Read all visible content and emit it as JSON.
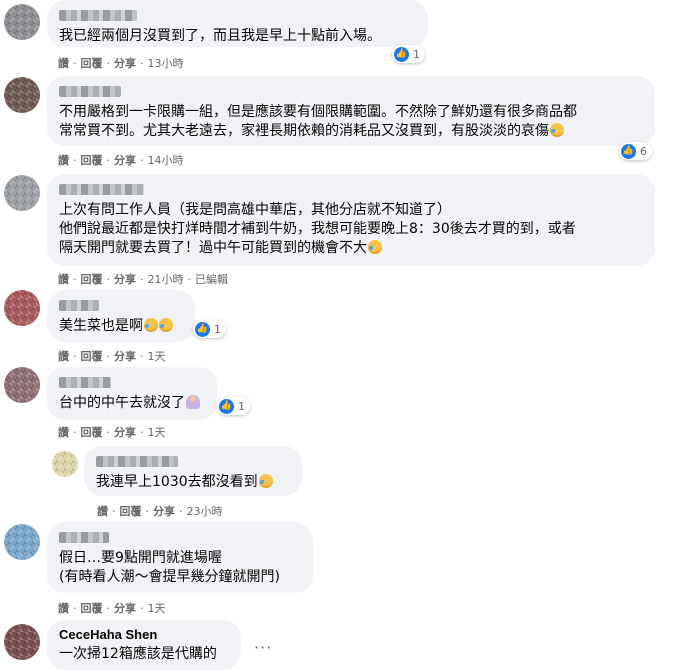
{
  "actions": {
    "like": "讚",
    "reply": "回覆",
    "share": "分享",
    "edited": "已編輯"
  },
  "comments": [
    {
      "text": "我已經兩個月沒買到了，而且我是早上十點前入場。",
      "reactions": "1",
      "time": "13小時"
    },
    {
      "text": "不用嚴格到一卡限購一組，但是應該要有個限購範圍。不然除了鮮奶還有很多商品都\n常常買不到。尤其大老遠去，家裡長期依賴的消耗品又沒買到，有股淡淡的哀傷",
      "reactions": "6",
      "time": "14小時"
    },
    {
      "text": "上次有問工作人員（我是問高雄中華店，其他分店就不知道了）\n他們說最近都是快打烊時間才補到牛奶，我想可能要晚上8：30後去才買的到，或者\n隔天開門就要去買了！過中午可能買到的機會不大",
      "time": "21小時"
    },
    {
      "text": "美生菜也是啊",
      "reactions": "1",
      "time": "1天"
    },
    {
      "text": "台中的中午去就沒了",
      "reactions": "1",
      "time": "1天"
    },
    {
      "text": "我連早上1030去都沒看到",
      "time": "23小時"
    },
    {
      "text": "假日…要9點開門就進場喔\n(有時看人潮～會提早幾分鐘就開門)",
      "time": "1天"
    },
    {
      "name": "CeceHaha Shen",
      "text": "一次掃12箱應該是代購的",
      "more": "···"
    }
  ],
  "colors": {
    "bubble": "#f0f2f5",
    "meta": "#65676b",
    "like": "#1877f2"
  }
}
